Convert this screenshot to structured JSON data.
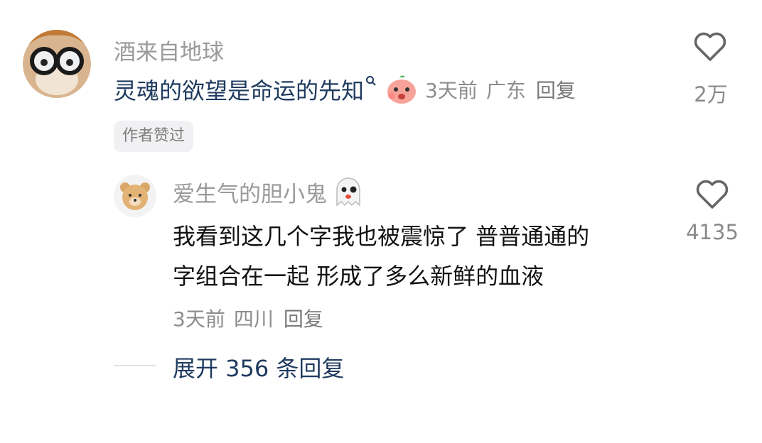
{
  "comment": {
    "username": "酒来自地球",
    "text": "灵魂的欲望是命运的先知",
    "timestamp": "3天前",
    "location": "广东",
    "reply_label": "回复",
    "like_count": "2万",
    "author_badge": "作者赞过"
  },
  "reply": {
    "username": "爱生气的胆小鬼",
    "line1": "我看到这几个字我也被震惊了 普普通通的",
    "line2": "字组合在一起 形成了多么新鲜的血液",
    "timestamp": "3天前",
    "location": "四川",
    "reply_label": "回复",
    "like_count": "4135"
  },
  "expand": {
    "label": "展开 356 条回复"
  },
  "colors": {
    "link_blue": "#1f3a5f",
    "text_dark": "#111111",
    "gray": "#9a9a9a"
  }
}
